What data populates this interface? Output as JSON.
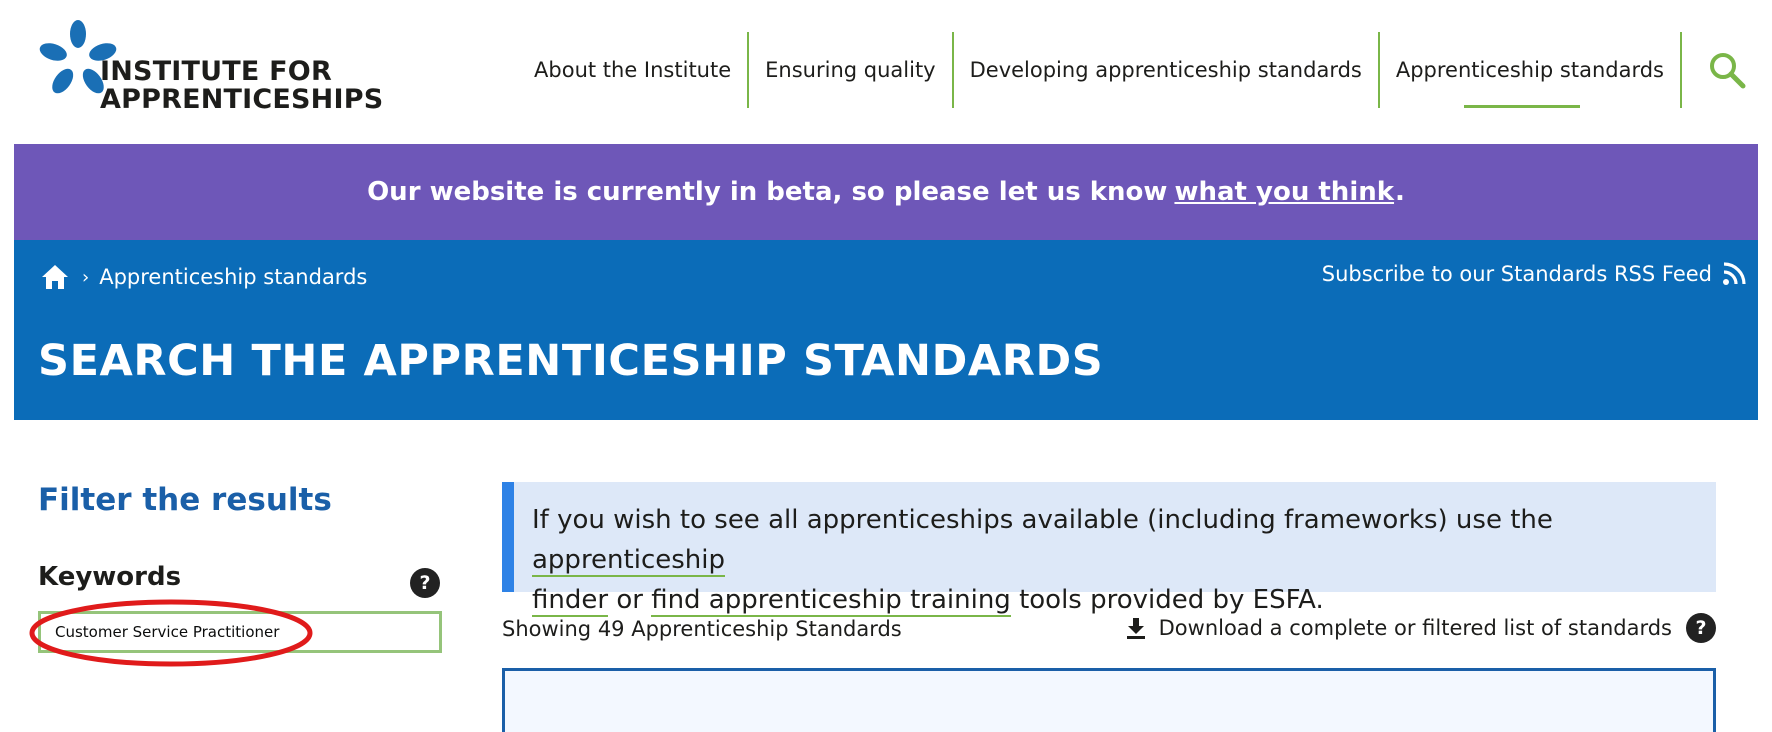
{
  "header": {
    "logo_line1": "INSTITUTE FOR",
    "logo_line2": "APPRENTICESHIPS",
    "nav": [
      {
        "label": "About the Institute"
      },
      {
        "label": "Ensuring quality"
      },
      {
        "label": "Developing apprenticeship standards"
      },
      {
        "label": "Apprenticeship standards",
        "active": true
      }
    ],
    "search_icon": "search-icon"
  },
  "beta_banner": {
    "text": "Our website is currently in beta, so please let us know",
    "link": "what you think",
    "period": "."
  },
  "hero": {
    "breadcrumb_current": "Apprenticeship standards",
    "breadcrumb_separator": "›",
    "rss_label": "Subscribe to our Standards RSS Feed",
    "title": "SEARCH THE APPRENTICESHIP STANDARDS"
  },
  "sidebar": {
    "filter_title": "Filter the results",
    "keywords_label": "Keywords",
    "help_glyph": "?",
    "keywords_value": "Customer Service Practitioner"
  },
  "main": {
    "info_prefix": "If you wish to see all apprenticeships available (including frameworks) use the",
    "info_link1_a": "apprenticeship",
    "info_link1_b": "finder",
    "info_or": "or",
    "info_link2": "find apprenticeship training",
    "info_suffix": "tools provided by ESFA.",
    "showing": "Showing 49 Apprenticeship Standards",
    "download_label": "Download a complete or filtered list of standards",
    "help_glyph": "?"
  },
  "colors": {
    "beta_purple": "#6e57b8",
    "hero_blue": "#0b6cb8",
    "accent_green": "#7ab648",
    "logo_blue": "#1a6fb5",
    "annotation_red": "#e01b1b"
  }
}
